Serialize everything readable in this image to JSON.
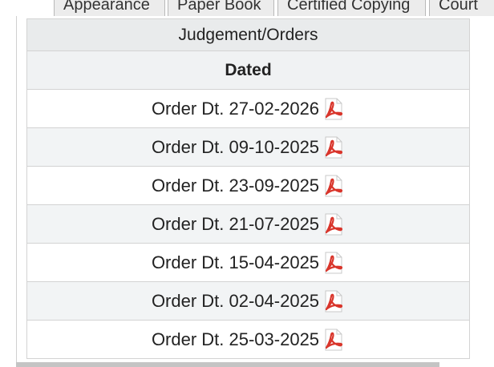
{
  "tabs": [
    {
      "label": "Appearance"
    },
    {
      "label": "Paper Book"
    },
    {
      "label": "Certified Copying"
    },
    {
      "label": "Court"
    }
  ],
  "section": {
    "title": "Judgement/Orders",
    "column_header": "Dated"
  },
  "orders": [
    {
      "label": "Order Dt. 27-02-2026",
      "icon": "pdf-icon"
    },
    {
      "label": "Order Dt. 09-10-2025",
      "icon": "pdf-icon"
    },
    {
      "label": "Order Dt. 23-09-2025",
      "icon": "pdf-icon"
    },
    {
      "label": "Order Dt. 21-07-2025",
      "icon": "pdf-icon"
    },
    {
      "label": "Order Dt. 15-04-2025",
      "icon": "pdf-icon"
    },
    {
      "label": "Order Dt. 02-04-2025",
      "icon": "pdf-icon"
    },
    {
      "label": "Order Dt. 25-03-2025",
      "icon": "pdf-icon"
    }
  ],
  "colors": {
    "pdf_red": "#d9352b",
    "header_bg": "#e9ebec",
    "alt_row_bg": "#f2f4f5",
    "border": "#d3d3d3"
  }
}
